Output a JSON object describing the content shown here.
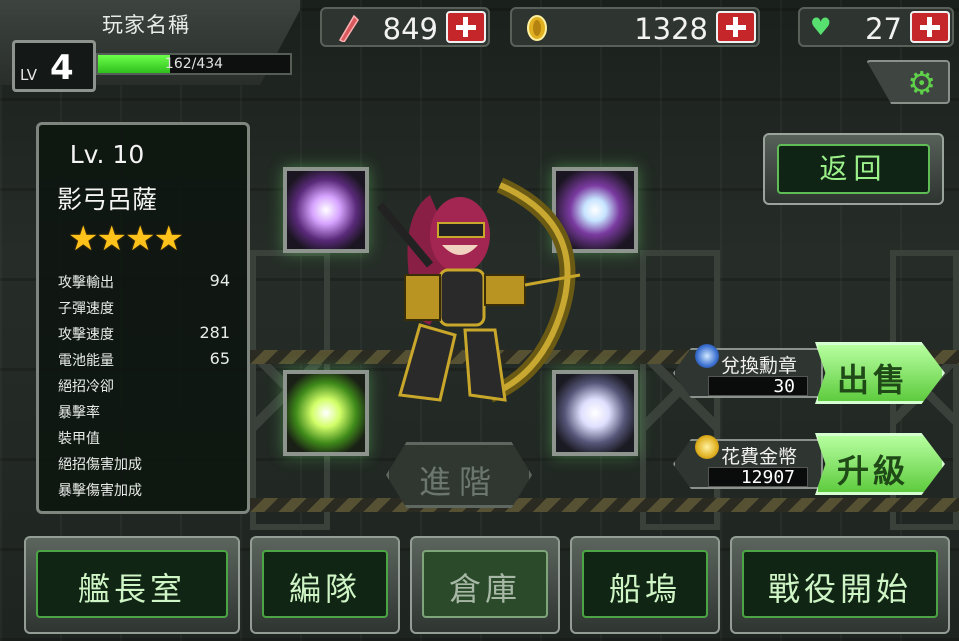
{
  "player": {
    "name": "玩家名稱",
    "lv_label": "LV",
    "level": "4",
    "xp_text": "162/434",
    "xp_fraction": 0.373
  },
  "resources": {
    "crystals": "849",
    "coins": "1328",
    "hearts": "27"
  },
  "icons": {
    "crystal": "red-crystal-icon",
    "coin": "gold-coin-icon",
    "heart": "green-heart-icon",
    "settings": "gear-icon",
    "plus": "plus-icon"
  },
  "unit": {
    "level": "Lv. 10",
    "name": "影弓呂薩",
    "stars": "★★★★",
    "star_count": 4,
    "stats": [
      {
        "label": "攻擊輸出",
        "value": "94"
      },
      {
        "label": "子彈速度",
        "value": ""
      },
      {
        "label": "攻擊速度",
        "value": "281"
      },
      {
        "label": "電池能量",
        "value": "65"
      },
      {
        "label": "絕招冷卻",
        "value": ""
      },
      {
        "label": "暴擊率",
        "value": ""
      },
      {
        "label": "裝甲值",
        "value": ""
      },
      {
        "label": "絕招傷害加成",
        "value": ""
      },
      {
        "label": "暴擊傷害加成",
        "value": ""
      }
    ]
  },
  "buttons": {
    "return": "返回",
    "promote": "進階"
  },
  "trade": {
    "sell": {
      "label": "兌換勳章",
      "value": "30",
      "action": "出售"
    },
    "upgrade": {
      "label": "花費金幣",
      "value": "12907",
      "action": "升級"
    }
  },
  "nav": {
    "captain_room": "艦長室",
    "formation": "編隊",
    "warehouse": "倉庫",
    "dock": "船塢",
    "campaign": "戰役開始"
  },
  "colors": {
    "accent_green": "#5ecb3e",
    "plus_red": "#c4262a",
    "star_gold": "#ffc21a"
  }
}
